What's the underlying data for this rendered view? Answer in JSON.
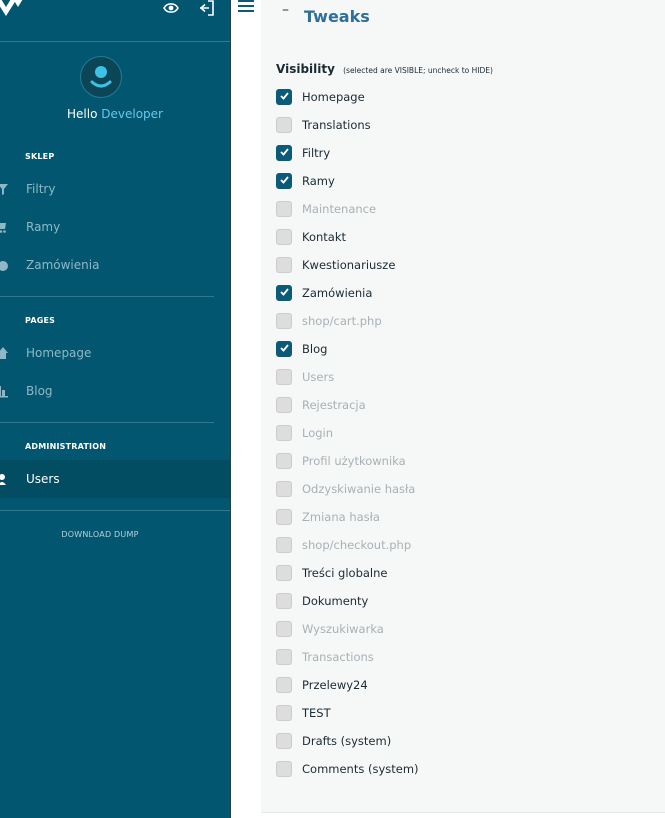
{
  "sidebar": {
    "hello": "Hello",
    "user_name": "Developer",
    "sections": [
      {
        "title": "SKLEP",
        "items": [
          {
            "label": "Filtry",
            "icon": "funnel-icon"
          },
          {
            "label": "Ramy",
            "icon": "cart-icon"
          },
          {
            "label": "Zamówienia",
            "icon": "order-icon"
          }
        ]
      },
      {
        "title": "PAGES",
        "items": [
          {
            "label": "Homepage",
            "icon": "home-icon"
          },
          {
            "label": "Blog",
            "icon": "blog-icon"
          }
        ]
      },
      {
        "title": "ADMINISTRATION",
        "items": [
          {
            "label": "Users",
            "icon": "user-icon",
            "active": true
          }
        ]
      }
    ],
    "download_dump": "DOWNLOAD DUMP"
  },
  "panel": {
    "collapse_symbol": "–",
    "title": "Tweaks",
    "visibility_label": "Visibility",
    "visibility_note": "(selected are VISIBLE; uncheck to HIDE)",
    "options": [
      {
        "label": "Homepage",
        "checked": true,
        "dim": false
      },
      {
        "label": "Translations",
        "checked": false,
        "dim": false
      },
      {
        "label": "Filtry",
        "checked": true,
        "dim": false
      },
      {
        "label": "Ramy",
        "checked": true,
        "dim": false
      },
      {
        "label": "Maintenance",
        "checked": false,
        "dim": true
      },
      {
        "label": "Kontakt",
        "checked": false,
        "dim": false
      },
      {
        "label": "Kwestionariusze",
        "checked": false,
        "dim": false
      },
      {
        "label": "Zamówienia",
        "checked": true,
        "dim": false
      },
      {
        "label": "shop/cart.php",
        "checked": false,
        "dim": true
      },
      {
        "label": "Blog",
        "checked": true,
        "dim": false
      },
      {
        "label": "Users",
        "checked": false,
        "dim": true
      },
      {
        "label": "Rejestracja",
        "checked": false,
        "dim": true
      },
      {
        "label": "Login",
        "checked": false,
        "dim": true
      },
      {
        "label": "Profil użytkownika",
        "checked": false,
        "dim": true
      },
      {
        "label": "Odzyskiwanie hasła",
        "checked": false,
        "dim": true
      },
      {
        "label": "Zmiana hasła",
        "checked": false,
        "dim": true
      },
      {
        "label": "shop/checkout.php",
        "checked": false,
        "dim": true
      },
      {
        "label": "Treści globalne",
        "checked": false,
        "dim": false
      },
      {
        "label": "Dokumenty",
        "checked": false,
        "dim": false
      },
      {
        "label": "Wyszukiwarka",
        "checked": false,
        "dim": true
      },
      {
        "label": "Transactions",
        "checked": false,
        "dim": true
      },
      {
        "label": "Przelewy24",
        "checked": false,
        "dim": false
      },
      {
        "label": "TEST",
        "checked": false,
        "dim": false
      },
      {
        "label": "Drafts (system)",
        "checked": false,
        "dim": false
      },
      {
        "label": "Comments (system)",
        "checked": false,
        "dim": false
      }
    ]
  },
  "colors": {
    "sidebar_bg": "#02566f",
    "accent": "#0b5a78",
    "title_blue": "#2d6f9a"
  }
}
